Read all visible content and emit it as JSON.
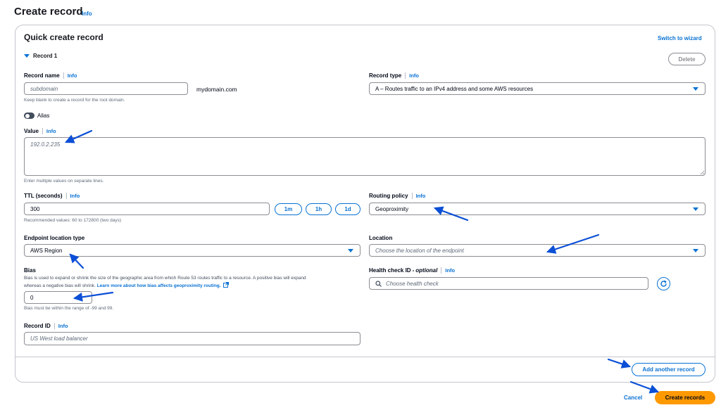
{
  "page": {
    "title": "Create record",
    "title_info": "Info"
  },
  "panel": {
    "title": "Quick create record",
    "switch_link": "Switch to wizard",
    "record_toggle": "Record 1",
    "delete_label": "Delete"
  },
  "record_name": {
    "label": "Record name",
    "info": "Info",
    "placeholder": "subdomain",
    "suffix": "mydomain.com",
    "hint": "Keep blank to create a record for the root domain."
  },
  "record_type": {
    "label": "Record type",
    "info": "Info",
    "value": "A – Routes traffic to an IPv4 address and some AWS resources"
  },
  "alias": {
    "label": "Alias",
    "enabled": false
  },
  "value": {
    "label": "Value",
    "info": "Info",
    "placeholder": "192.0.2.235",
    "hint": "Enter multiple values on separate lines."
  },
  "ttl": {
    "label": "TTL (seconds)",
    "info": "Info",
    "value": "300",
    "buttons": [
      "1m",
      "1h",
      "1d"
    ],
    "hint": "Recommended values: 60 to 172800 (two days)"
  },
  "routing_policy": {
    "label": "Routing policy",
    "info": "Info",
    "value": "Geoproximity"
  },
  "endpoint_location_type": {
    "label": "Endpoint location type",
    "value": "AWS Region"
  },
  "location": {
    "label": "Location",
    "placeholder": "Choose the location of the endpoint"
  },
  "bias": {
    "label": "Bias",
    "description_1": "Bias is used to expand or shrink the size of the geographic area from which Route 53 routes traffic to a resource. A positive bias will expand",
    "description_2": "whereas a negative bias will shrink.",
    "learn_more": "Learn more about how bias affects geoproximity routing.",
    "value": "0",
    "hint": "Bias must be within the range of -99 and 99."
  },
  "health_check": {
    "label": "Health check ID",
    "label_optional": "optional",
    "info": "Info",
    "placeholder": "Choose health check"
  },
  "record_id": {
    "label": "Record ID",
    "info": "Info",
    "placeholder": "US West load balancer"
  },
  "footer": {
    "add_another": "Add another record",
    "cancel": "Cancel",
    "create": "Create records"
  },
  "colors": {
    "accent": "#0972d3",
    "primary_button": "#ff9900",
    "annotation_arrow": "#0b4fd6"
  },
  "icons": [
    "caret-down-icon",
    "search-icon",
    "refresh-icon",
    "external-link-icon",
    "toggle-icon"
  ]
}
